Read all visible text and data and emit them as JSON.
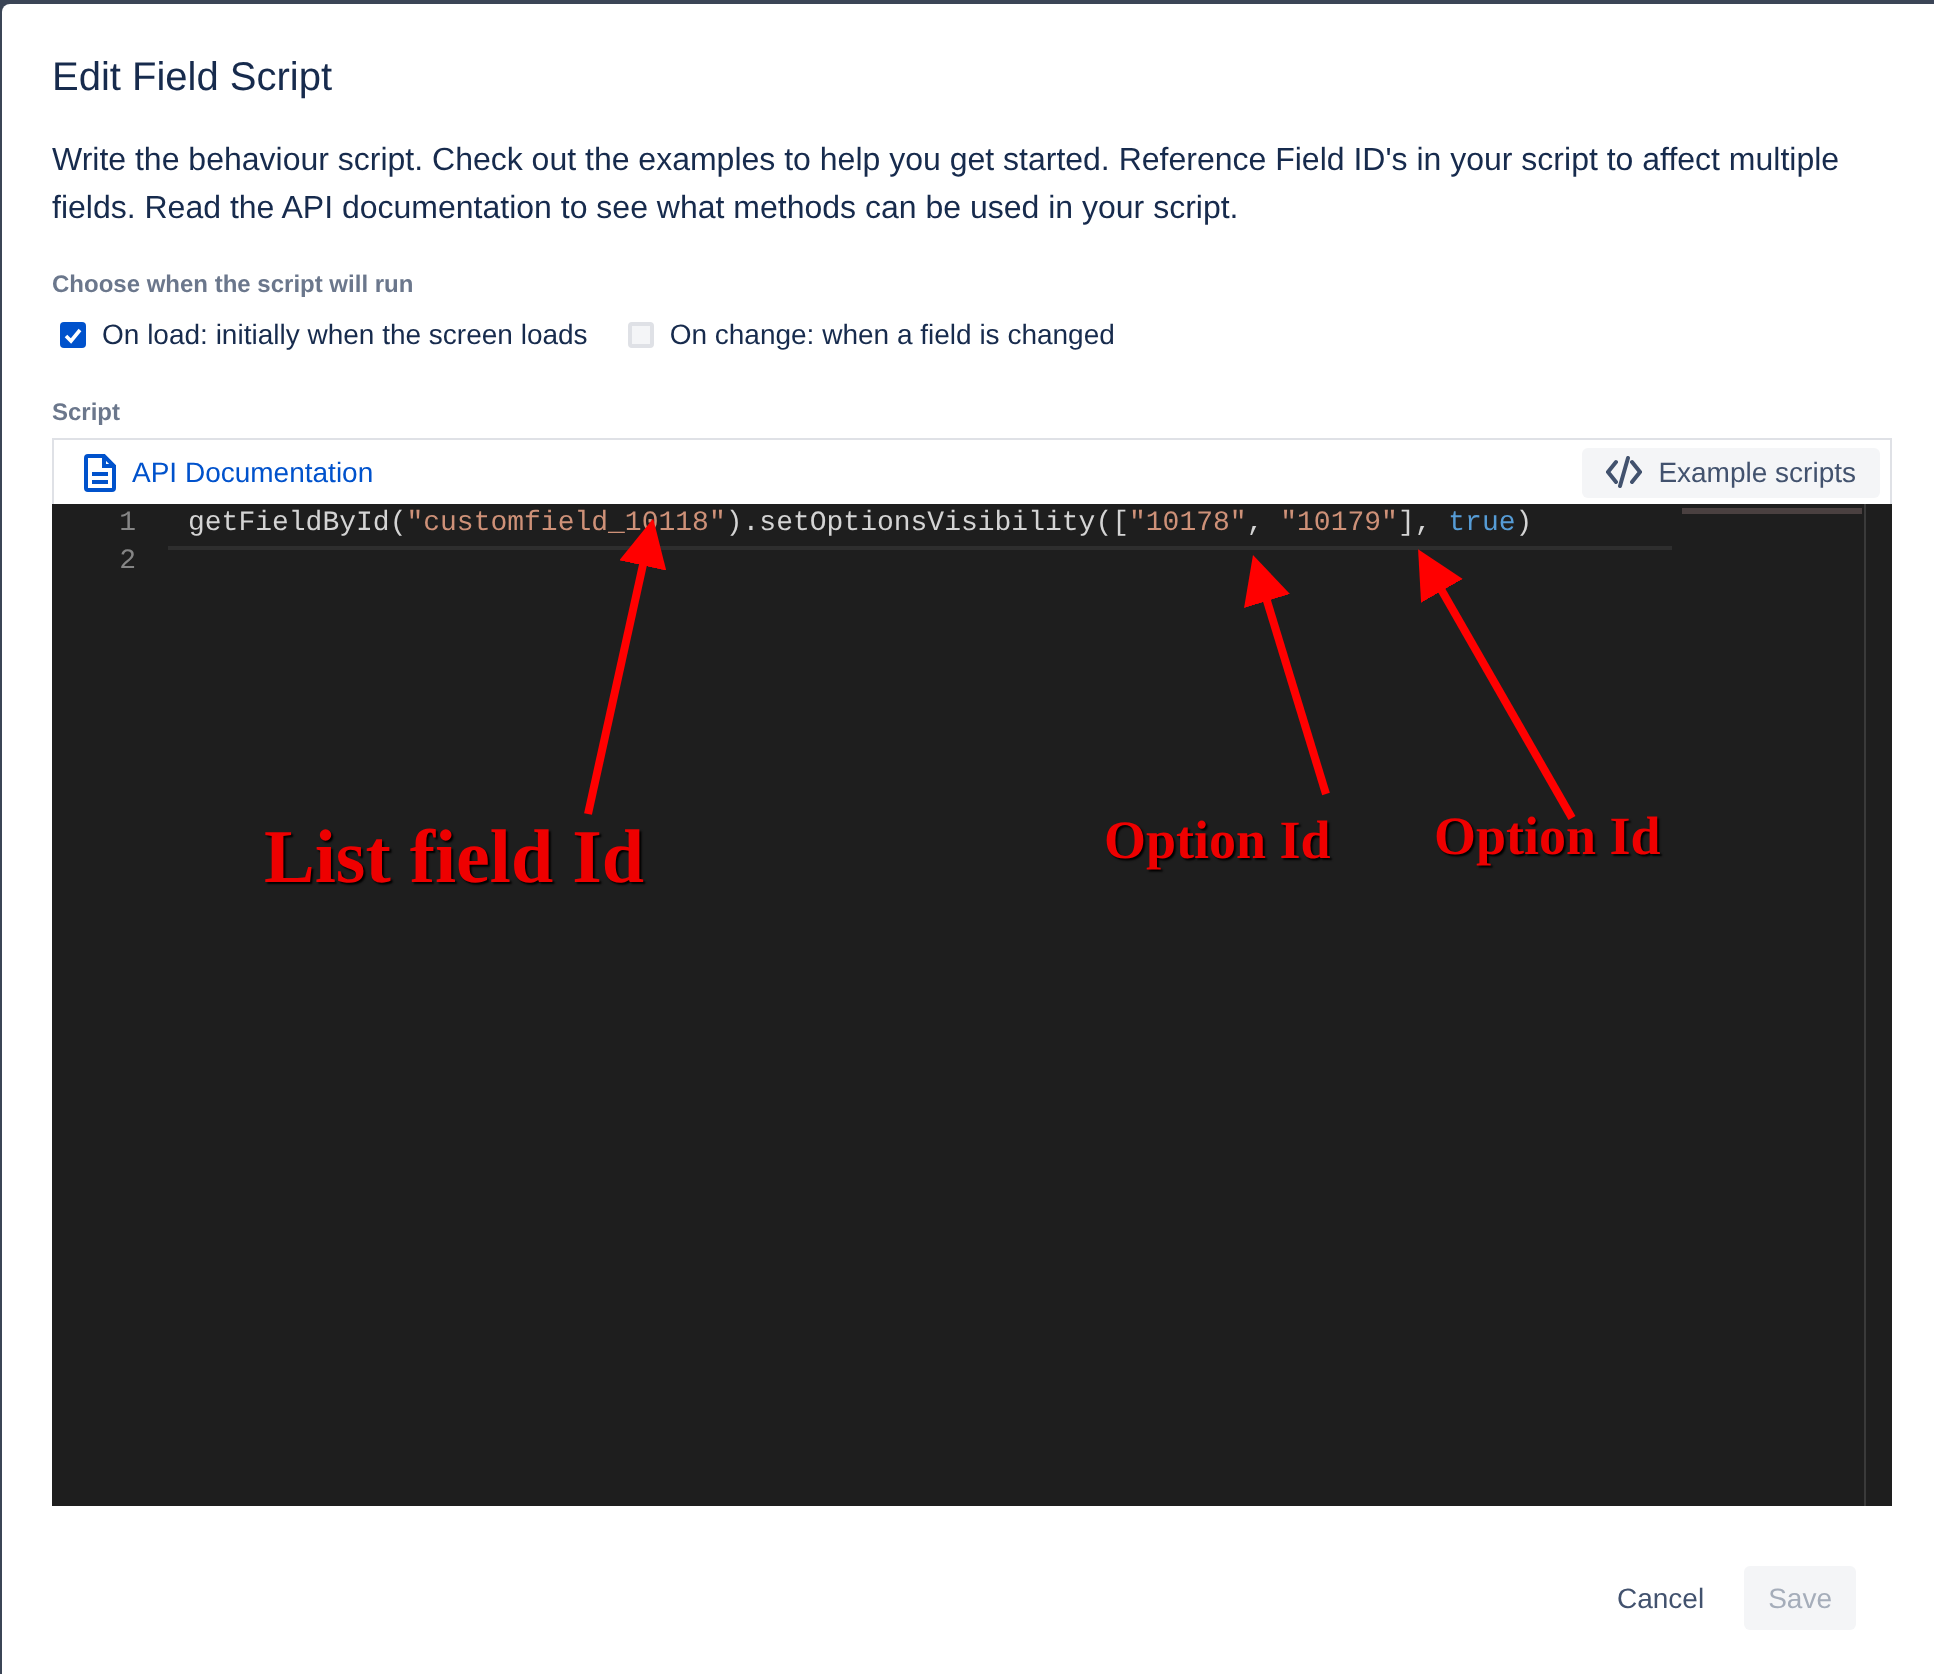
{
  "dialog": {
    "title": "Edit Field Script",
    "description": "Write the behaviour script. Check out the examples to help you get started. Reference Field ID's in your script to affect multiple fields. Read the API documentation to see what methods can be used in your script."
  },
  "run_options": {
    "label": "Choose when the script will run",
    "options": [
      {
        "label": "On load: initially when the screen loads",
        "checked": true
      },
      {
        "label": "On change: when a field is changed",
        "checked": false
      }
    ]
  },
  "script": {
    "label": "Script",
    "toolbar": {
      "docs_link": "API Documentation",
      "examples_button": "Example scripts"
    },
    "lines": [
      {
        "number": "1",
        "tokens": [
          {
            "kind": "plain",
            "text": "getFieldById("
          },
          {
            "kind": "string",
            "text": "\"customfield_10118\""
          },
          {
            "kind": "plain",
            "text": ").setOptionsVisibility(["
          },
          {
            "kind": "string",
            "text": "\"10178\""
          },
          {
            "kind": "plain",
            "text": ", "
          },
          {
            "kind": "string",
            "text": "\"10179\""
          },
          {
            "kind": "plain",
            "text": "], "
          },
          {
            "kind": "keyword",
            "text": "true"
          },
          {
            "kind": "plain",
            "text": ")"
          }
        ]
      },
      {
        "number": "2"
      }
    ]
  },
  "annotations": [
    {
      "label": "List field Id"
    },
    {
      "label": "Option Id"
    },
    {
      "label": "Option Id"
    }
  ],
  "buttons": [
    {
      "label": "Cancel",
      "disabled": false
    },
    {
      "label": "Save",
      "disabled": true
    }
  ]
}
